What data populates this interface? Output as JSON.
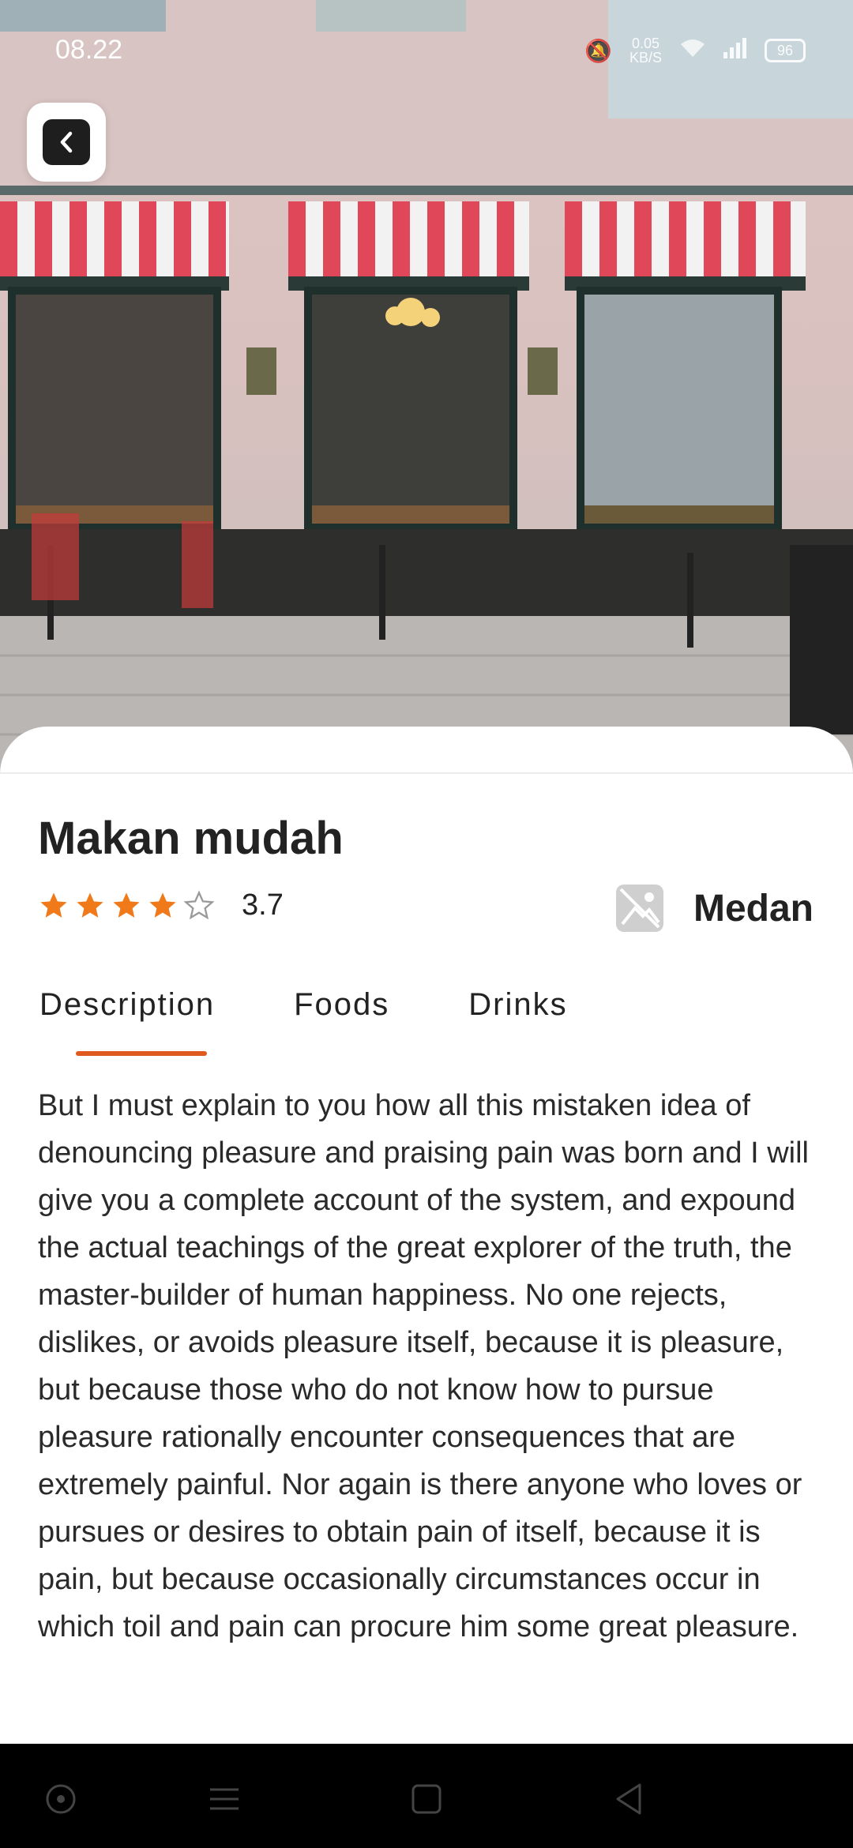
{
  "status_bar": {
    "time": "08.22",
    "speed": "0.05",
    "speed_unit": "KB/S",
    "battery": "96"
  },
  "header": {
    "back_label": ""
  },
  "place": {
    "title": "Makan mudah",
    "rating": "3.7",
    "rating_stars": 3.7,
    "location": "Medan"
  },
  "tabs": [
    {
      "label": "Description",
      "active": true
    },
    {
      "label": "Foods",
      "active": false
    },
    {
      "label": "Drinks",
      "active": false
    }
  ],
  "description": "But I must explain to you how all this mistaken idea of denouncing pleasure and praising pain was born and I will give you a complete account of the system, and expound the actual teachings of the great explorer of the truth, the master-builder of human happiness. No one rejects, dislikes, or avoids pleasure itself, because it is pleasure, but because those who do not know how to pursue pleasure rationally encounter consequences that are extremely painful. Nor again is there anyone who loves or pursues or desires to obtain pain of itself, because it is pain, but because occasionally circumstances occur in which toil and pain can procure him some great pleasure.",
  "colors": {
    "accent": "#e05a1f",
    "star": "#f07a1a",
    "awning_red": "#e0485a"
  },
  "icons": {
    "back": "chevron-left-icon",
    "location": "image-placeholder-icon",
    "nav_home": "circle-icon",
    "nav_menu": "menu-icon",
    "nav_square": "square-icon",
    "nav_back": "triangle-back-icon"
  }
}
